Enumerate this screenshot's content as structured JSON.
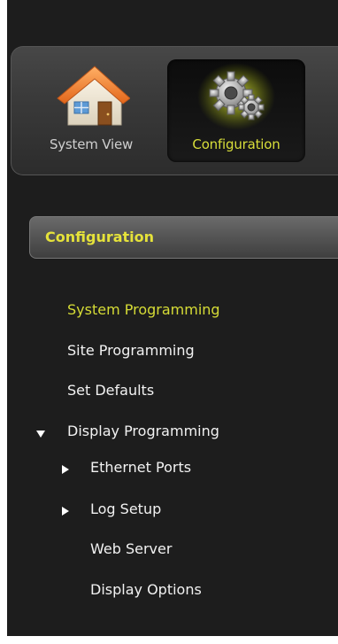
{
  "toolbar": {
    "system_view": {
      "label": "System View",
      "icon": "house-icon"
    },
    "configuration": {
      "label": "Configuration",
      "icon": "gears-icon",
      "selected": true
    }
  },
  "section": {
    "title": "Configuration"
  },
  "menu": {
    "items": [
      {
        "label": "System Programming",
        "active": true
      },
      {
        "label": "Site Programming"
      },
      {
        "label": "Set Defaults"
      },
      {
        "label": "Display Programming",
        "expanded": true,
        "icon": "caret-down-icon"
      },
      {
        "label": "Ethernet Ports",
        "icon": "caret-right-icon"
      },
      {
        "label": "Log Setup",
        "icon": "caret-right-icon"
      },
      {
        "label": "Web Server"
      },
      {
        "label": "Display Options"
      }
    ]
  },
  "colors": {
    "background": "#1d1d1d",
    "accent": "#d6dc36",
    "text": "#f2f2f2"
  }
}
